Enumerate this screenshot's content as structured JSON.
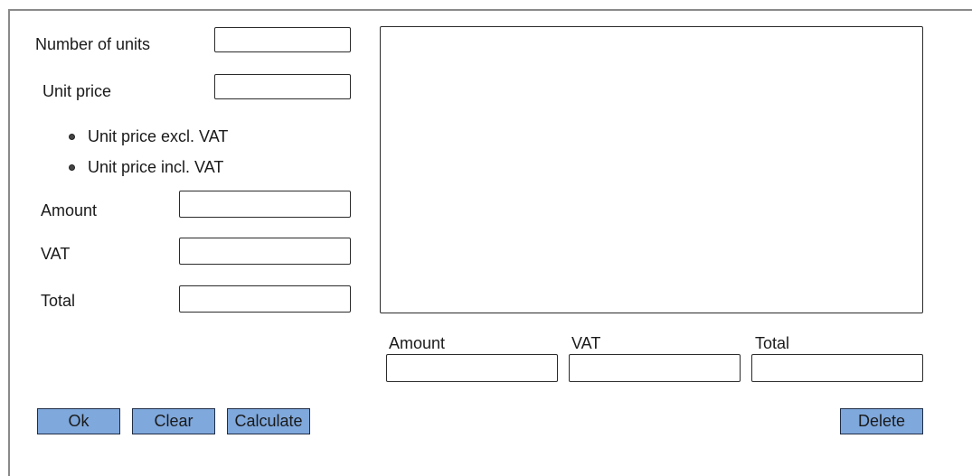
{
  "form": {
    "units_label": "Number of units",
    "unit_price_label": "Unit price",
    "price_options": [
      "Unit price excl. VAT",
      "Unit price incl. VAT"
    ],
    "amount_label": "Amount",
    "vat_label": "VAT",
    "total_label": "Total",
    "units_value": "",
    "unit_price_value": "",
    "amount_value": "",
    "vat_value": "",
    "total_value": ""
  },
  "summary": {
    "amount_label": "Amount",
    "vat_label": "VAT",
    "total_label": "Total",
    "amount_value": "",
    "vat_value": "",
    "total_value": ""
  },
  "buttons": {
    "ok": "Ok",
    "clear": "Clear",
    "calculate": "Calculate",
    "delete": "Delete"
  },
  "colors": {
    "button_fill": "#7fa8dc",
    "border": "#2b2b2b"
  }
}
